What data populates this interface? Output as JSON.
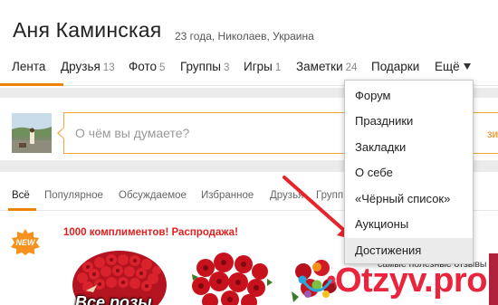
{
  "profile": {
    "name": "Аня Каминская",
    "info": "23 года, Николаев, Украина"
  },
  "nav": {
    "items": [
      {
        "label": "Лента",
        "count": ""
      },
      {
        "label": "Друзья",
        "count": "13"
      },
      {
        "label": "Фото",
        "count": "5"
      },
      {
        "label": "Группы",
        "count": "3"
      },
      {
        "label": "Игры",
        "count": "1"
      },
      {
        "label": "Заметки",
        "count": "24"
      },
      {
        "label": "Подарки",
        "count": ""
      },
      {
        "label": "Ещё",
        "count": ""
      }
    ]
  },
  "status": {
    "placeholder": "О чём вы думаете?",
    "share_label": "зить"
  },
  "feed": {
    "tabs": [
      "Всё",
      "Популярное",
      "Обсуждаемое",
      "Избранное",
      "Друзья",
      "Групп"
    ]
  },
  "promo": {
    "badge": "NEW",
    "title": "1000 комплиментов! Распродажа!",
    "caption": "Все розы",
    "side_text": "самые полезные отзывы"
  },
  "dropdown": {
    "items": [
      "Форум",
      "Праздники",
      "Закладки",
      "О себе",
      "«Чёрный список»",
      "Аукционы",
      "Достижения"
    ]
  },
  "watermark": {
    "text": "Otzyv.pro"
  },
  "colors": {
    "accent": "#ee8208",
    "promo_red": "#e02020",
    "annotation_arrow": "#e8242a",
    "watermark_red": "#e9243c"
  }
}
